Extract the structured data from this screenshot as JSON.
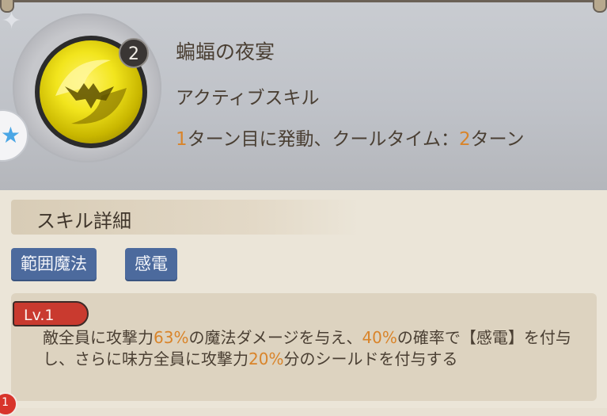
{
  "skill": {
    "level_badge": "2",
    "name": "蝙蝠の夜宴",
    "type": "アクティブスキル",
    "timing": {
      "start_turn": "1",
      "text_a": "ターン目に発動、クールタイム：",
      "cooldown": "2",
      "text_b": "ターン"
    }
  },
  "details": {
    "header": "スキル詳細",
    "tags": [
      "範囲魔法",
      "感電"
    ],
    "level_label": "Lv.1",
    "description": {
      "p1": "敵全員に攻撃力",
      "v1": "63%",
      "p2": "の魔法ダメージを与え、",
      "v2": "40%",
      "p3": "の確率で【感電】を付与し、さらに味方全員に攻撃力",
      "v3": "20%",
      "p4": "分のシールドを付与する"
    }
  },
  "notification": {
    "count": "1"
  },
  "colors": {
    "highlight": "#d9842a",
    "tag_bg": "#4c6a9d",
    "level_tag_bg": "#c93a2f",
    "icon_gold": "#f2e51d"
  },
  "icons": {
    "skill_icon": "bat-swirl-icon",
    "side_icon": "star-icon",
    "sparkle": "sparkle-icon"
  }
}
